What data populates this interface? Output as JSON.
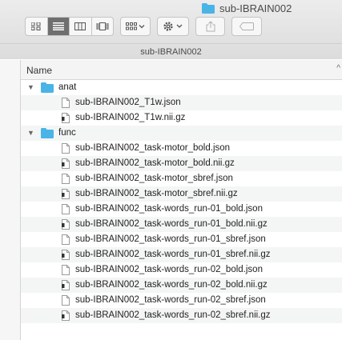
{
  "window": {
    "title": "sub-IBRAIN002"
  },
  "toolbar": {
    "view_buttons": [
      "icon-view",
      "list-view",
      "column-view",
      "cover-flow-view"
    ],
    "selected_view": "list-view"
  },
  "pathbar": {
    "label": "sub-IBRAIN002"
  },
  "list": {
    "column_name": "Name",
    "rows": [
      {
        "label": "anat",
        "type": "folder",
        "expanded": true
      },
      {
        "label": "sub-IBRAIN002_T1w.json",
        "type": "file"
      },
      {
        "label": "sub-IBRAIN002_T1w.nii.gz",
        "type": "binary"
      },
      {
        "label": "func",
        "type": "folder",
        "expanded": true
      },
      {
        "label": "sub-IBRAIN002_task-motor_bold.json",
        "type": "file"
      },
      {
        "label": "sub-IBRAIN002_task-motor_bold.nii.gz",
        "type": "binary"
      },
      {
        "label": "sub-IBRAIN002_task-motor_sbref.json",
        "type": "file"
      },
      {
        "label": "sub-IBRAIN002_task-motor_sbref.nii.gz",
        "type": "binary"
      },
      {
        "label": "sub-IBRAIN002_task-words_run-01_bold.json",
        "type": "file"
      },
      {
        "label": "sub-IBRAIN002_task-words_run-01_bold.nii.gz",
        "type": "binary"
      },
      {
        "label": "sub-IBRAIN002_task-words_run-01_sbref.json",
        "type": "file"
      },
      {
        "label": "sub-IBRAIN002_task-words_run-01_sbref.nii.gz",
        "type": "binary"
      },
      {
        "label": "sub-IBRAIN002_task-words_run-02_bold.json",
        "type": "file"
      },
      {
        "label": "sub-IBRAIN002_task-words_run-02_bold.nii.gz",
        "type": "binary"
      },
      {
        "label": "sub-IBRAIN002_task-words_run-02_sbref.json",
        "type": "file"
      },
      {
        "label": "sub-IBRAIN002_task-words_run-02_sbref.nii.gz",
        "type": "binary"
      }
    ]
  },
  "colors": {
    "folder": "#4ab4e6",
    "selected_segment": "#6f6f6f"
  }
}
